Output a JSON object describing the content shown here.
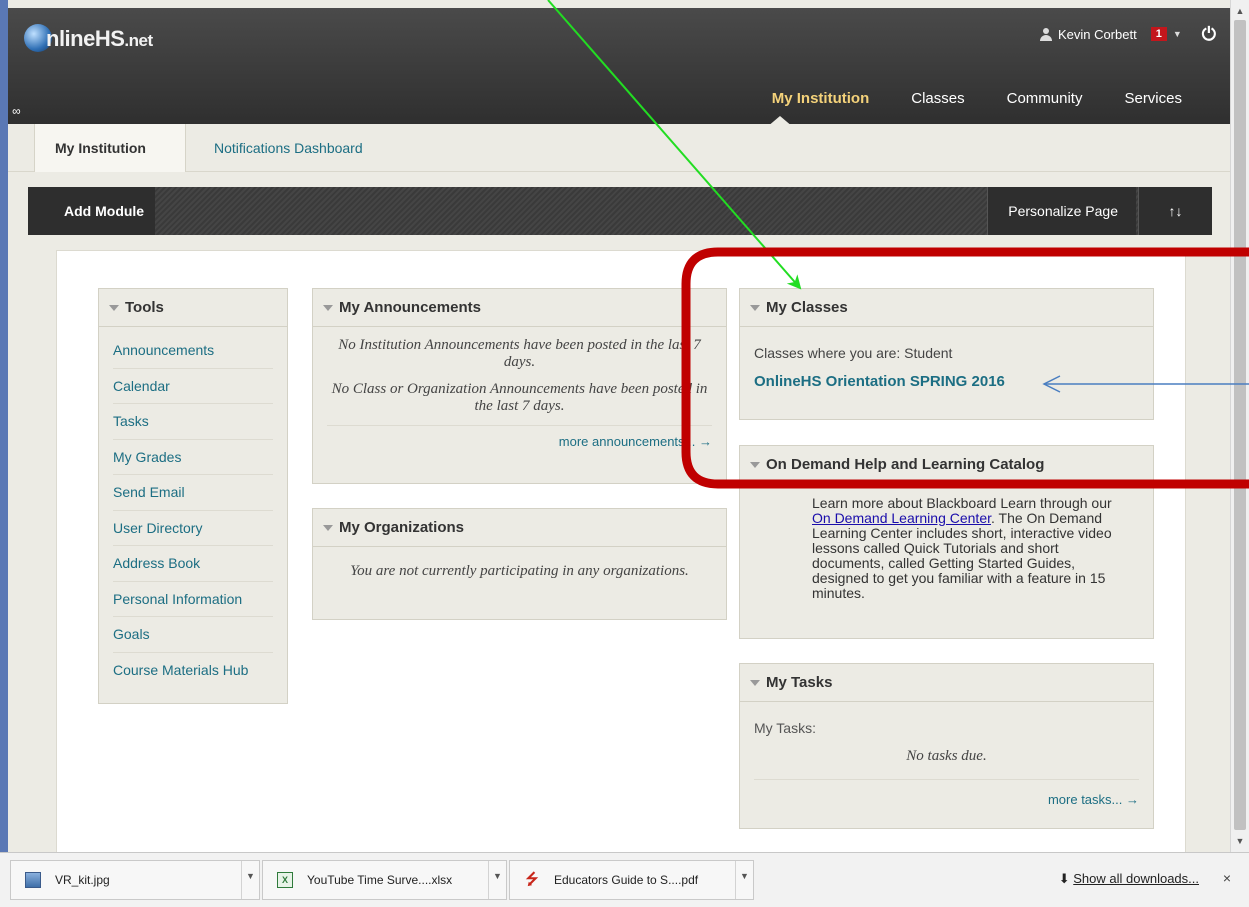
{
  "header": {
    "logo_text_a": "nline",
    "logo_text_b": "HS",
    "logo_text_c": ".net",
    "user_name": "Kevin Corbett",
    "notification_count": "1",
    "nav": [
      {
        "label": "My Institution"
      },
      {
        "label": "Classes"
      },
      {
        "label": "Community"
      },
      {
        "label": "Services"
      }
    ]
  },
  "subtabs": {
    "active": "My Institution",
    "link": "Notifications Dashboard"
  },
  "module_bar": {
    "add": "Add Module",
    "personalize": "Personalize Page",
    "sort_icon": "↑↓"
  },
  "tools": {
    "title": "Tools",
    "items": [
      "Announcements",
      "Calendar",
      "Tasks",
      "My Grades",
      "Send Email",
      "User Directory",
      "Address Book",
      "Personal Information",
      "Goals",
      "Course Materials Hub"
    ]
  },
  "announcements": {
    "title": "My Announcements",
    "line1": "No Institution Announcements have been posted in the last 7 days.",
    "line2": "No Class or Organization Announcements have been posted in the last 7 days.",
    "more": "more announcements... →"
  },
  "organizations": {
    "title": "My Organizations",
    "text": "You are not currently participating in any organizations."
  },
  "classes": {
    "title": "My Classes",
    "role": "Classes where you are: Student",
    "course": "OnlineHS Orientation SPRING 2016"
  },
  "help": {
    "title": "On Demand Help and Learning Catalog",
    "text_before": "Learn more about Blackboard Learn through our ",
    "link": "On Demand Learning Center",
    "text_after": ". The On Demand Learning Center includes short, interactive video lessons called Quick Tutorials and short documents, called Getting Started Guides, designed to get you familiar with a feature in 15 minutes."
  },
  "tasks": {
    "title": "My Tasks",
    "label": "My Tasks:",
    "none": "No tasks due.",
    "more": "more tasks... →"
  },
  "downloads": {
    "items": [
      {
        "name": "VR_kit.jpg"
      },
      {
        "name": "YouTube Time Surve....xlsx"
      },
      {
        "name": "Educators Guide to S....pdf"
      }
    ],
    "show_all": "Show all downloads...",
    "close": "×"
  },
  "colors": {
    "annotation_red": "#c00000",
    "annotation_green": "#22dd22",
    "annotation_blue": "#4a7ec0",
    "link": "#1c6e83"
  }
}
